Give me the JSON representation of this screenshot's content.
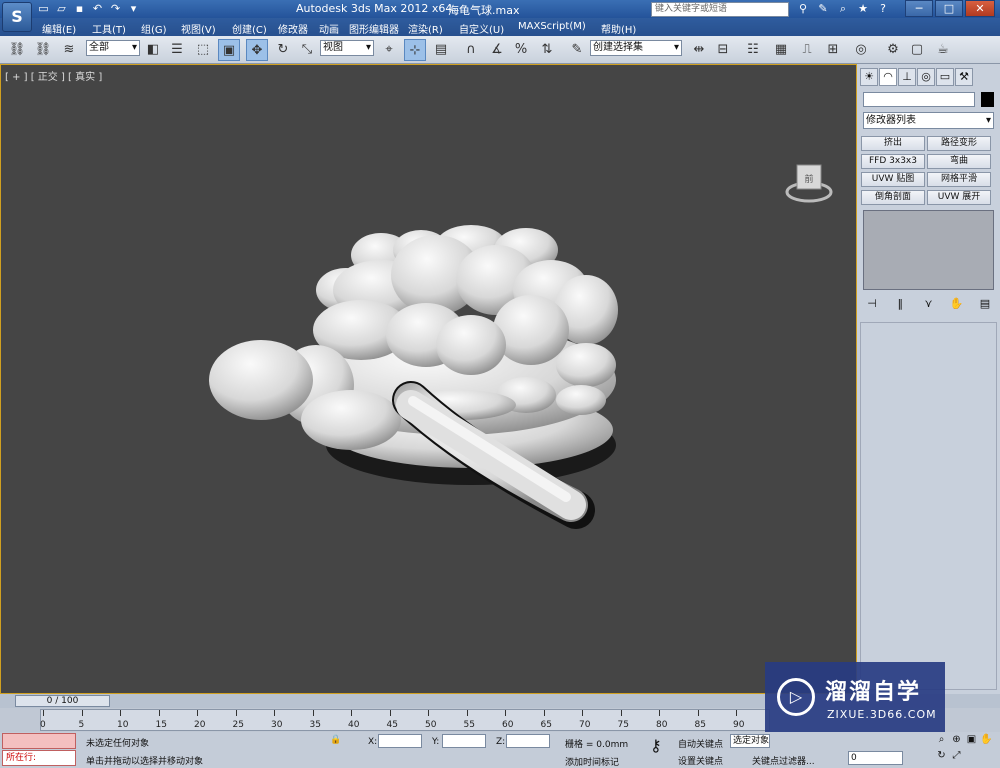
{
  "window": {
    "app_title": "Autodesk 3ds Max  2012 x64",
    "file_name": "海龟气球.max",
    "search_placeholder": "键入关键字或短语",
    "app_icon_glyph": "S",
    "minimize_glyph": "─",
    "maximize_glyph": "□",
    "close_glyph": "✕"
  },
  "quick_access": [
    {
      "name": "new-file-icon",
      "glyph": "▭"
    },
    {
      "name": "open-file-icon",
      "glyph": "▱"
    },
    {
      "name": "save-icon",
      "glyph": "▪"
    },
    {
      "name": "undo-icon",
      "glyph": "↶"
    },
    {
      "name": "redo-icon",
      "glyph": "↷"
    },
    {
      "name": "qat-dropdown-icon",
      "glyph": "▾"
    }
  ],
  "title_icons": [
    {
      "name": "binoculars-icon",
      "glyph": "⚲"
    },
    {
      "name": "tools-icon",
      "glyph": "✎"
    },
    {
      "name": "magnifier-icon",
      "glyph": "⌕"
    },
    {
      "name": "star-icon",
      "glyph": "★"
    },
    {
      "name": "help-icon",
      "glyph": "?"
    }
  ],
  "menu": [
    "编辑(E)",
    "工具(T)",
    "组(G)",
    "视图(V)",
    "创建(C)",
    "修改器",
    "动画",
    "图形编辑器",
    "渲染(R)",
    "自定义(U)",
    "MAXScript(M)",
    "帮助(H)"
  ],
  "toolbar": {
    "selection_filter": "全部",
    "ref_coord": "视图",
    "named_selection": "创建选择集",
    "snap_label": "3",
    "percent_label": "%",
    "icons": [
      "link-icon",
      "unlink-icon",
      "bind-spacewarp-icon",
      "select-object-icon",
      "select-by-name-icon",
      "rect-select-icon",
      "window-crossing-icon",
      "move-icon",
      "rotate-icon",
      "scale-icon",
      "pivot-icon",
      "manipulate-icon",
      "keyboard-shortcut-icon",
      "snap-toggle-icon",
      "angle-snap-icon",
      "percent-snap-icon",
      "spinner-snap-icon",
      "edit-named-selection-icon",
      "mirror-icon",
      "align-icon",
      "layer-manager-icon",
      "graphite-ribbon-icon",
      "curve-editor-icon",
      "schematic-view-icon",
      "material-editor-icon",
      "render-setup-icon",
      "rendered-frame-icon",
      "render-icon"
    ]
  },
  "viewport": {
    "label": "[ + ] [ 正交 ] [ 真实 ]",
    "cube_face": "前"
  },
  "command_panel": {
    "tabs": [
      "create-tab-icon",
      "modify-tab-icon",
      "hierarchy-tab-icon",
      "motion-tab-icon",
      "display-tab-icon",
      "utilities-tab-icon"
    ],
    "modifier_list": "修改器列表",
    "modifier_buttons": [
      "挤出",
      "路径变形",
      "FFD 3x3x3",
      "弯曲",
      "UVW 贴图",
      "网格平滑",
      "倒角剖面",
      "UVW 展开"
    ],
    "stack_icons": [
      "pin-stack-icon",
      "show-end-result-icon",
      "make-unique-icon",
      "remove-modifier-icon",
      "configure-sets-icon"
    ]
  },
  "timeline": {
    "slider": "0 / 100",
    "ticks": [
      "0",
      "5",
      "10",
      "15",
      "20",
      "25",
      "30",
      "35",
      "40",
      "45",
      "50",
      "55",
      "60",
      "65",
      "70",
      "75",
      "80",
      "85",
      "90"
    ]
  },
  "status": {
    "running_label": "所在行:",
    "selection_msg": "未选定任何对象",
    "prompt_msg": "单击并拖动以选择并移动对象",
    "x_label": "X:",
    "y_label": "Y:",
    "z_label": "Z:",
    "grid": "栅格 = 0.0mm",
    "add_time_tag": "添加时间标记",
    "auto_key": "自动关键点",
    "selected_obj": "选定对象",
    "set_key": "设置关键点",
    "key_filters": "关键点过滤器...",
    "frame_value": "0"
  },
  "watermark": {
    "cn": "溜溜自学",
    "url": "ZIXUE.3D66.COM"
  },
  "colors": {
    "viewport_bg": "#454545",
    "viewport_border": "#d0a020",
    "title_blue": "#2f5c9e"
  }
}
